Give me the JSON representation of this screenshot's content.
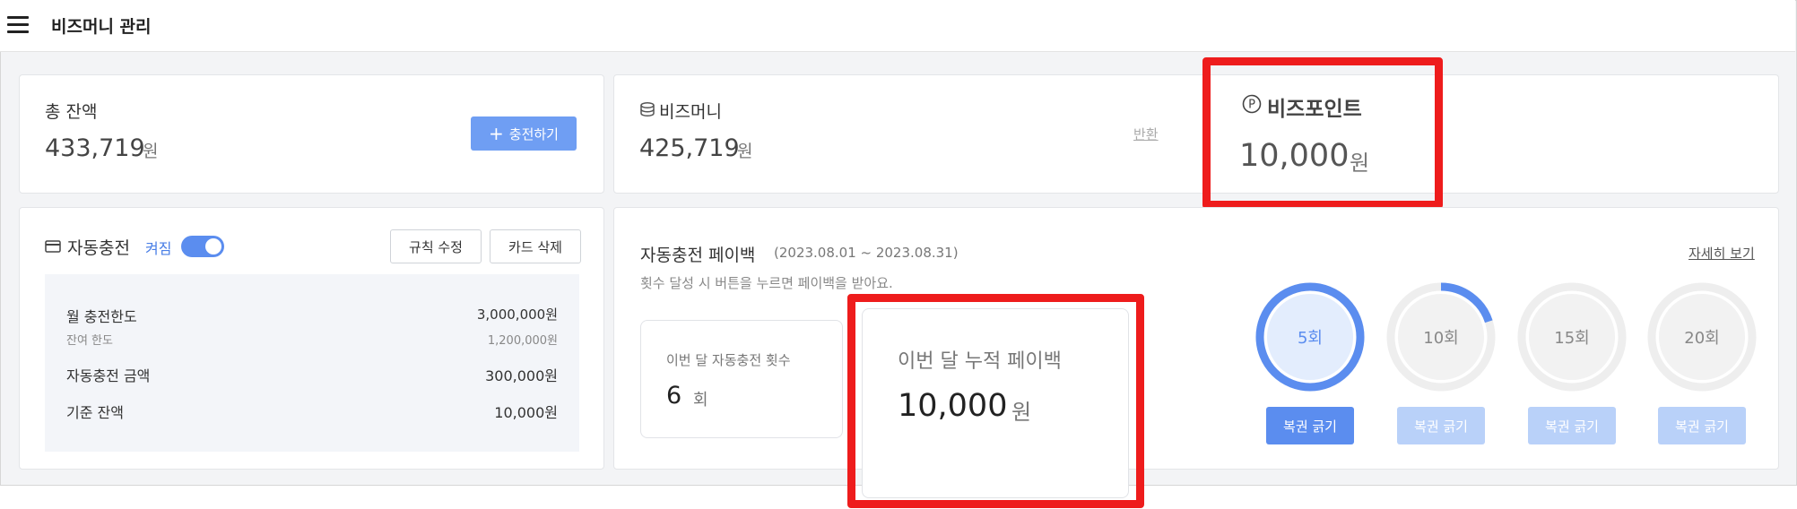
{
  "header": {
    "title": "비즈머니 관리",
    "menu_icon": "hamburger-icon"
  },
  "total_balance": {
    "label": "총 잔액",
    "amount": "433,719",
    "unit": "원",
    "charge_button": "충전하기"
  },
  "bizmoney": {
    "label": "비즈머니",
    "amount": "425,719",
    "unit": "원",
    "refund_link": "반환",
    "icon": "coin-stack-icon"
  },
  "bizpoint": {
    "label": "비즈포인트",
    "amount": "10,000",
    "unit": "원",
    "icon": "circle-p-icon"
  },
  "auto_charge": {
    "title": "자동충전",
    "status": "켜짐",
    "toggle_on": true,
    "edit_rule_button": "규칙 수정",
    "delete_card_button": "카드 삭제",
    "monthly_limit": {
      "label": "월 충전한도",
      "value": "3,000,000원"
    },
    "remaining_limit": {
      "label": "잔여 한도",
      "value": "1,200,000원"
    },
    "charge_amount": {
      "label": "자동충전 금액",
      "value": "300,000원"
    },
    "base_balance": {
      "label": "기준 잔액",
      "value": "10,000원"
    }
  },
  "payback": {
    "title": "자동충전 페이백",
    "period": "(2023.08.01 ~ 2023.08.31)",
    "description": "횟수 달성 시 버튼을 누르면 페이백을 받아요.",
    "details_link": "자세히 보기",
    "count_card": {
      "label": "이번 달 자동충전 횟수",
      "value": "6",
      "unit": "회"
    },
    "accum_card": {
      "label": "이번 달 누적 페이백",
      "value": "10,000",
      "unit": "원"
    },
    "milestones": [
      {
        "label": "5회",
        "progress": 1.0,
        "button": "복권 긁기",
        "enabled": true
      },
      {
        "label": "10회",
        "progress": 0.2,
        "button": "복권 긁기",
        "enabled": false
      },
      {
        "label": "15회",
        "progress": 0,
        "button": "복권 긁기",
        "enabled": false
      },
      {
        "label": "20회",
        "progress": 0,
        "button": "복권 긁기",
        "enabled": false
      }
    ]
  },
  "colors": {
    "accent": "#5b8def",
    "highlight": "#ee1c1c",
    "ring_track": "#eeeeee",
    "ring_active_fill": "#e3edfd",
    "button_disabled": "#b9d1f9"
  }
}
